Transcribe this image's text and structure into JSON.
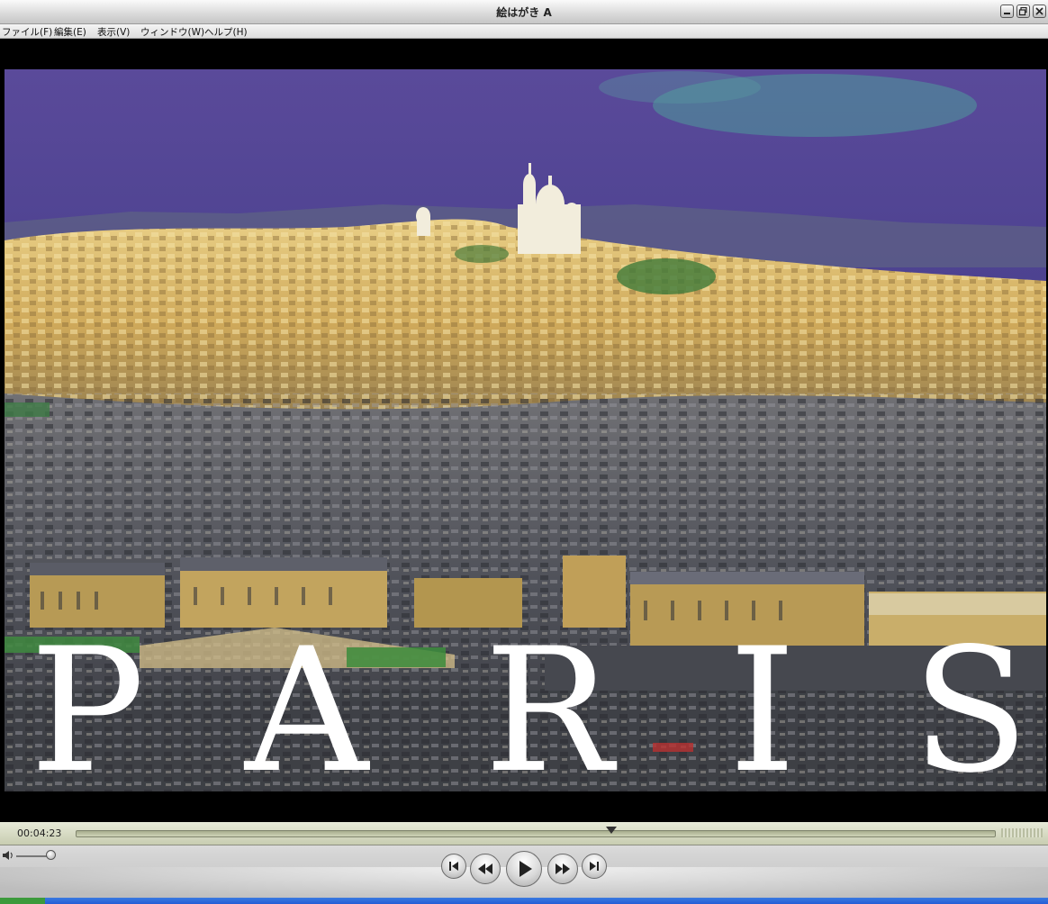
{
  "window": {
    "title": "絵はがき A",
    "controls": [
      "minimize-icon",
      "restore-icon",
      "close-icon"
    ]
  },
  "menubar": {
    "items": [
      "ファイル(F)",
      "編集(E)",
      "表示(V)",
      "ウィンドウ(W)",
      "ヘルプ(H)"
    ]
  },
  "video": {
    "content": "postcard-paris-photo",
    "overlay_word": "PARIS"
  },
  "controls": {
    "time": "00:04:23",
    "progress_fraction": 0.583,
    "volume_fraction": 0.9,
    "buttons": [
      "skip-to-start-icon",
      "rewind-icon",
      "play-icon",
      "fast-forward-icon",
      "skip-to-end-icon"
    ]
  },
  "colors": {
    "sky": "#4a3f8c",
    "city_gold": "#d9b860",
    "city_gray": "#5a5c62",
    "panel": "#d4d4d4",
    "timebar": "#d2d6be"
  }
}
